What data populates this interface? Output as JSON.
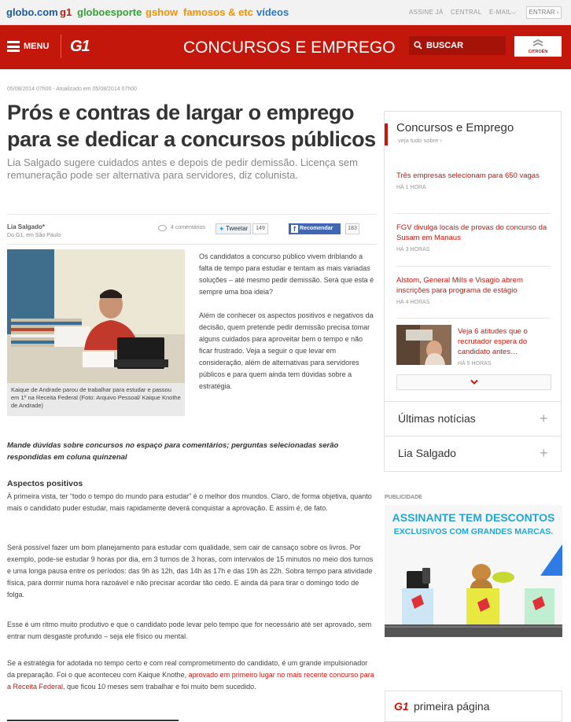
{
  "topbar": {
    "brands": [
      "globo.com",
      "g1",
      "globoesporte",
      "gshow",
      "famosos & etc",
      "vídeos"
    ],
    "brand_colors": [
      "#1a5ba6",
      "#c4170c",
      "#35a236",
      "#f39200",
      "#f39200",
      "#2a7ac4"
    ],
    "links": [
      "ASSINE JÁ",
      "CENTRAL",
      "E-MAIL"
    ],
    "login": "ENTRAR"
  },
  "header": {
    "menu_label": "MENU",
    "logo": "G1",
    "section": "CONCURSOS E EMPREGO",
    "search_label": "BUSCAR",
    "sponsor": "CITROËN",
    "brand_color": "#c4170c"
  },
  "article": {
    "meta": "05/08/2014 07h00 - Atualizado em 05/08/2014 07h00",
    "title": "Prós e contras de largar o emprego para se dedicar a concursos públicos",
    "subtitle": "Lia Salgado sugere cuidados antes e depois de pedir demissão. Licença sem remuneração pode ser alternativa para servidores, diz colunista.",
    "author": "Lia Salgado*",
    "location": "Do G1, em São Paulo",
    "comments": "4 comentários",
    "tweet_label": "Tweetar",
    "tweet_count": "149",
    "fb_label": "Recomendar",
    "fb_count": "183",
    "photo_caption": "Kaique de Andrade parou de trabalhar para estudar e passou em 1º na Receita Federal (Foto: Arquivo Pessoal/ Kaique Knothe de Andrade)",
    "lead_1": "Os candidatos a concurso público vivem driblando a falta de tempo para estudar e tentam as mais variadas soluções – até mesmo pedir demissão. Será que esta é sempre uma boa ideia?",
    "lead_2": "Além de conhecer os aspectos positivos e negativos da decisão, quem pretende pedir demissão precisa tomar alguns cuidados para aproveitar bem o tempo e não ficar frustrado. Veja a seguir o que levar em consideração, além de alternativas para servidores públicos e para quem ainda tem dúvidas sobre a estratégia.",
    "callout": "Mande dúvidas sobre concursos no espaço para comentários; perguntas selecionadas serão respondidas em coluna quinzenal",
    "subheading": "Aspectos positivos",
    "p1": "À primeira vista, ter “todo o tempo do mundo para estudar” é o melhor dos mundos. Claro, de forma objetiva, quanto mais o candidato puder estudar, mais rapidamente deverá conquistar a aprovação. E assim é, de fato.",
    "p2": "Será possível fazer um bom planejamento para estudar com qualidade, sem cair de cansaço sobre os livros. Por exemplo, pode-se estudar 9 horas por dia, em 3 turnos de 3 horas, com intervalos de 15 minutos no meio dos turnos e uma longa pausa entre os períodos: das 9h às 12h, das 14h às 17h e das 19h às 22h. Sobra tempo para atividade física, para dormir numa hora razoável e não precisar acordar tão cedo. E ainda dá para tirar o domingo todo de folga.",
    "p3": "Esse é um ritmo muito produtivo e que o candidato pode levar pelo tempo que for necessário até ser aprovado, sem entrar num desgaste profundo – seja ele físico ou mental.",
    "p4_before": "Se a estratégia for adotada no tempo certo e com real comprometimento do candidato, é um grande impulsionador da preparação. Foi o que aconteceu com Kaique Knothe, ",
    "p4_link": "aprovado em primeiro lugar no mais recente concurso para a Receita Federal",
    "p4_after": ", que ficou 10 meses sem trabalhar e foi muito bem sucedido."
  },
  "sidebar": {
    "title": "Concursos e Emprego",
    "see_all": "veja tudo sobre ›",
    "items": [
      {
        "title": "Três empresas selecionam para 650 vagas",
        "time": "HÁ 1 HORA"
      },
      {
        "title": "FGV divulga locais de provas do concurso da Susam em Manaus",
        "time": "HÁ 3 HORAS"
      },
      {
        "title": "Alstom, General Mills e Visagio abrem inscrições para programa de estágio",
        "time": "HÁ 4 HORAS"
      },
      {
        "title": "Veja 6 atitudes que o recrutador espera do candidato antes…",
        "time": "HÁ 5 HORAS"
      }
    ],
    "accordion": [
      "Últimas notícias",
      "Lia Salgado"
    ]
  },
  "ad": {
    "label": "PUBLICIDADE",
    "line1": "ASSINANTE TEM DESCONTOS",
    "line2": "EXCLUSIVOS COM GRANDES MARCAS."
  },
  "primeira": {
    "logo": "G1",
    "label": "primeira página"
  }
}
